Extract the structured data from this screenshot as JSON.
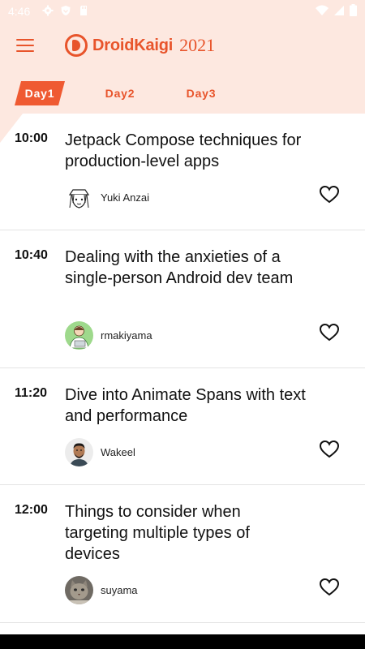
{
  "status_bar": {
    "time": "4:46",
    "icons": [
      "gear-icon",
      "shield-icon",
      "sd-card-icon",
      "wifi-icon",
      "signal-icon",
      "battery-icon"
    ]
  },
  "app_bar": {
    "menu_icon": "hamburger-menu-icon",
    "logo_text": "DroidKaigi",
    "logo_year": "2021",
    "accent_color": "#e8542b",
    "background_color": "#fde8e0"
  },
  "tabs": [
    {
      "label": "Day1",
      "active": true
    },
    {
      "label": "Day2",
      "active": false
    },
    {
      "label": "Day3",
      "active": false
    }
  ],
  "sessions": [
    {
      "time": "10:00",
      "title": "Jetpack Compose techniques for production-level apps",
      "speaker": "Yuki Anzai",
      "avatar_icon": "manga-avatar-icon",
      "favorite_icon": "heart-outline-icon"
    },
    {
      "time": "10:40",
      "title": "Dealing with the anxieties of a single-person Android dev team",
      "speaker": "rmakiyama",
      "avatar_icon": "illustrated-avatar-icon",
      "favorite_icon": "heart-outline-icon"
    },
    {
      "time": "11:20",
      "title": "Dive into Animate Spans with text and performance",
      "speaker": "Wakeel",
      "avatar_icon": "photo-avatar-icon",
      "favorite_icon": "heart-outline-icon"
    },
    {
      "time": "12:00",
      "title": "Things to consider when targeting multiple types of devices",
      "speaker": "suyama",
      "avatar_icon": "cat-avatar-icon",
      "favorite_icon": "heart-outline-icon"
    }
  ]
}
